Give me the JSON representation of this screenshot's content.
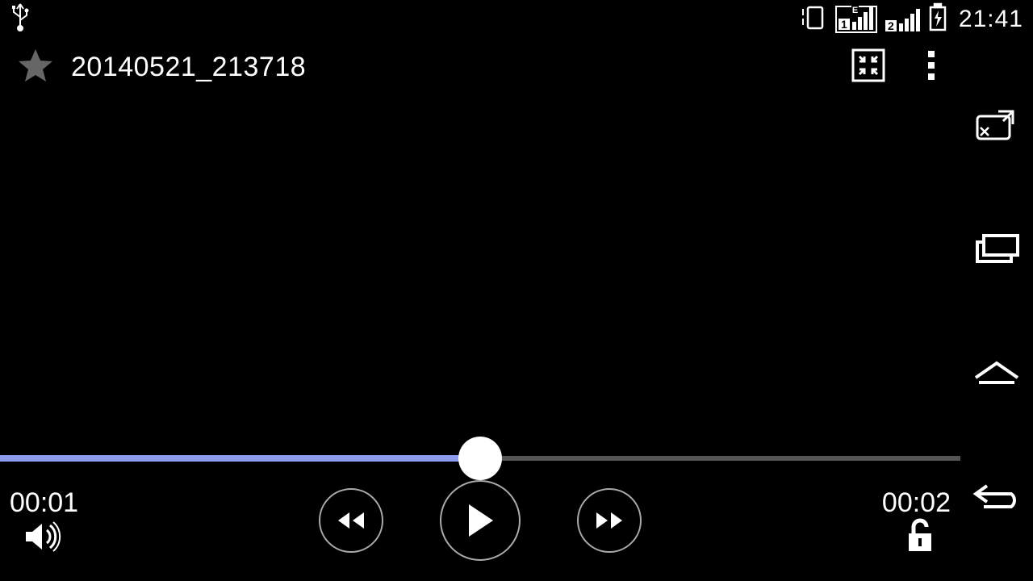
{
  "statusbar": {
    "clock": "21:41",
    "sim1_label": "1",
    "sim2_label": "2",
    "data_label": "E"
  },
  "title": {
    "filename": "20140521_213718"
  },
  "player": {
    "elapsed": "00:01",
    "total": "00:02",
    "progress_percent": 50
  }
}
